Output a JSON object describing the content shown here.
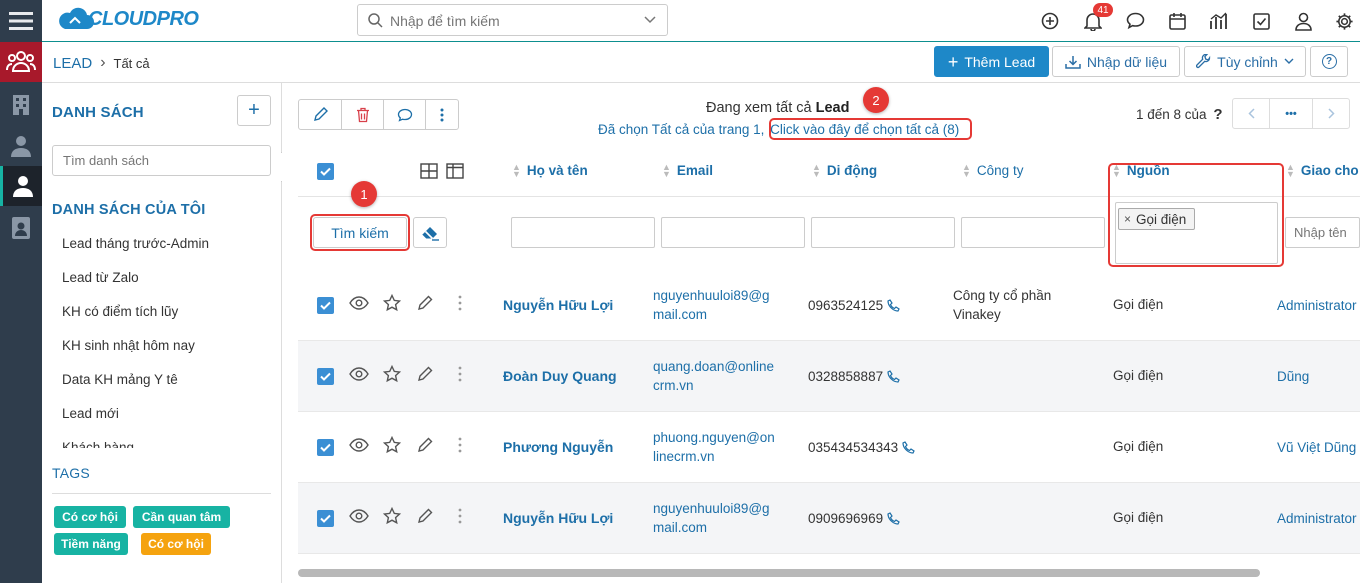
{
  "brand": {
    "logo_text": "CLOUDPRO"
  },
  "topbar": {
    "search_placeholder": "Nhập để tìm kiếm",
    "notification_count": "41"
  },
  "breadcrumb": {
    "module": "LEAD",
    "separator": "›",
    "current": "Tất cả"
  },
  "actions": {
    "add_lead": "Thêm Lead",
    "import": "Nhập dữ liệu",
    "customize": "Tùy chỉnh",
    "help": "?"
  },
  "sidebar": {
    "lists_title": "DANH SÁCH",
    "add_label": "+",
    "list_search_placeholder": "Tìm danh sách",
    "my_lists_title": "DANH SÁCH CỦA TÔI",
    "items": [
      {
        "label": "Lead tháng trước-Admin"
      },
      {
        "label": "Lead từ Zalo"
      },
      {
        "label": "KH có điểm tích lũy"
      },
      {
        "label": "KH sinh nhật hôm nay"
      },
      {
        "label": "Data KH mảng Y tê"
      },
      {
        "label": "Lead mới"
      },
      {
        "label": "Khách hàng"
      }
    ],
    "tags_title": "TAGS",
    "tags": [
      {
        "label": "Có cơ hội",
        "color": "#17b3a3"
      },
      {
        "label": "Cần quan tâm",
        "color": "#17b3a3"
      },
      {
        "label": "Tiềm năng",
        "color": "#17b3a3"
      },
      {
        "label": "Có cơ hội",
        "color": "#f5a30f"
      }
    ]
  },
  "main": {
    "viewing_prefix": "Đang xem tất cả",
    "viewing_module": "Lead",
    "selected_text": "Đã chọn Tất cả của trang 1,",
    "select_all_link": "Click vào đây để chọn tất cả (8)",
    "pagination": "1 đến 8 của",
    "pagination_unknown": "?",
    "more": "•••",
    "search_button": "Tìm kiếm",
    "annotation_1": "1",
    "annotation_2": "2",
    "columns": [
      "Họ và tên",
      "Email",
      "Di động",
      "Công ty",
      "Nguồn",
      "Giao cho"
    ],
    "source_filter_tag": "Gọi điện",
    "assignee_placeholder": "Nhập tên",
    "rows": [
      {
        "name": "Nguyễn Hữu Lợi",
        "email_1": "nguyenhuuloi89@g",
        "email_2": "mail.com",
        "mobile": "0963524125",
        "company_1": "Công ty cổ phần",
        "company_2": "Vinakey",
        "source": "Gọi điện",
        "assignee": "Administrator"
      },
      {
        "name": "Đoàn Duy Quang",
        "email_1": "quang.doan@online",
        "email_2": "crm.vn",
        "mobile": "0328858887",
        "company_1": "",
        "company_2": "",
        "source": "Gọi điện",
        "assignee": "Dũng"
      },
      {
        "name": "Phương Nguyễn",
        "email_1": "phuong.nguyen@on",
        "email_2": "linecrm.vn",
        "mobile": "035434534343",
        "company_1": "",
        "company_2": "",
        "source": "Gọi điện",
        "assignee": "Vũ Việt Dũng"
      },
      {
        "name": "Nguyễn Hữu Lợi",
        "email_1": "nguyenhuuloi89@g",
        "email_2": "mail.com",
        "mobile": "0909696969",
        "company_1": "",
        "company_2": "",
        "source": "Gọi điện",
        "assignee": "Administrator"
      }
    ]
  },
  "colors": {
    "accent": "#1e88c8",
    "rail": "#2f3d4c",
    "annotation": "#e53935",
    "rail_active": "#a8192b"
  }
}
